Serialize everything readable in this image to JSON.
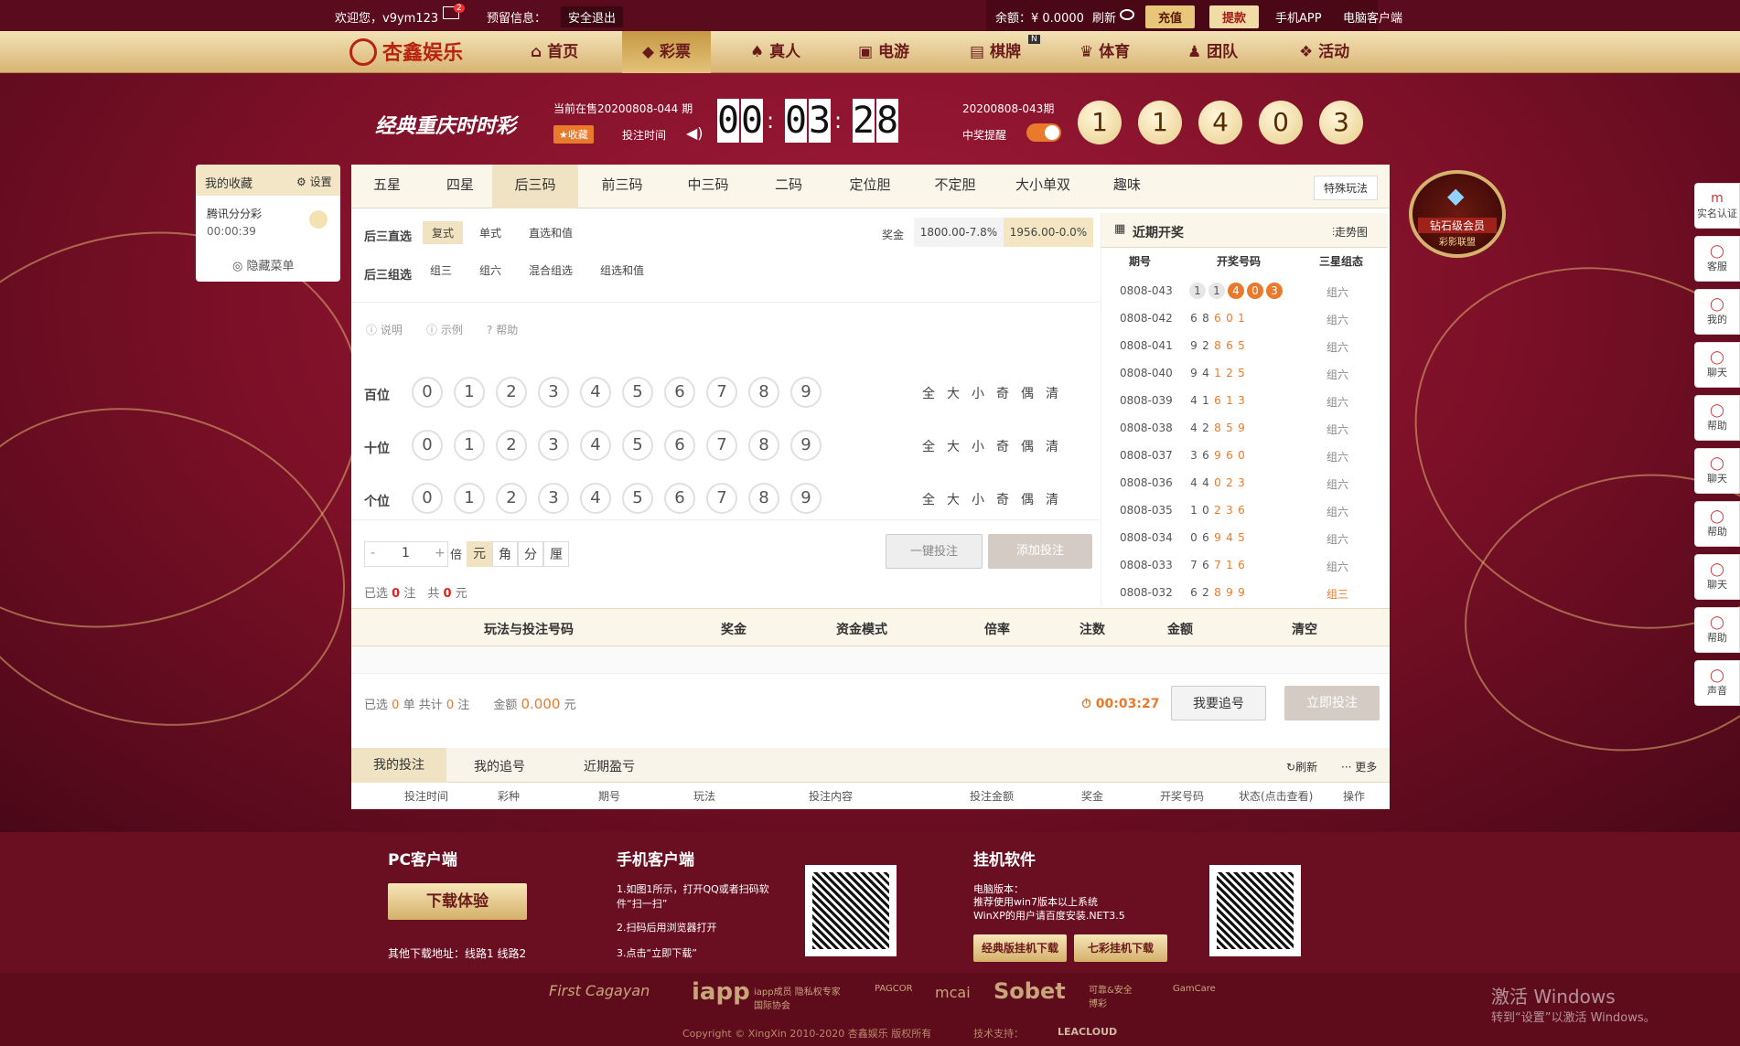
{
  "topbar": {
    "welcome": "欢迎您，v9ym123",
    "mail_count": "2",
    "notice_label": "预留信息：",
    "logout": "安全退出",
    "balance": "余额：¥ 0.0000",
    "refresh": "刷新",
    "recharge": "充值",
    "withdraw": "提款",
    "mobile_app": "手机APP",
    "pc_client": "电脑客户端"
  },
  "nav": {
    "logo": "杏鑫娱乐",
    "items": [
      "首页",
      "彩票",
      "真人",
      "电游",
      "棋牌",
      "体育",
      "团队",
      "活动"
    ],
    "active": "彩票",
    "badge": "N"
  },
  "lottery": {
    "name": "经典重庆时时彩",
    "selling": "当前在售20200808-044 期",
    "favorite": "收藏",
    "bet_time_label": "投注时间",
    "countdown": [
      "0",
      "0",
      "0",
      "3",
      "2",
      "8"
    ],
    "last_issue": "20200808-043期",
    "win_notice": "中奖提醒",
    "last_draw": [
      "1",
      "1",
      "4",
      "0",
      "3"
    ]
  },
  "favorites": {
    "title": "我的收藏",
    "settings": "设置",
    "item_name": "腾讯分分彩",
    "item_time": "00:00:39",
    "hide_menu": "隐藏菜单"
  },
  "tabs": [
    "五星",
    "四星",
    "后三码",
    "前三码",
    "中三码",
    "二码",
    "定位胆",
    "不定胆",
    "大小单双",
    "趣味"
  ],
  "active_tab": "后三码",
  "special_play": "特殊玩法",
  "play": {
    "direct_label": "后三直选",
    "direct_opts": [
      "复式",
      "单式",
      "直选和值"
    ],
    "group_label": "后三组选",
    "group_opts": [
      "组三",
      "组六",
      "混合组选",
      "组选和值"
    ],
    "prize_label": "奖金",
    "prize_opts": [
      "1800.00-7.8%",
      "1956.00-0.0%"
    ]
  },
  "help": [
    "说明",
    "示例",
    "帮助"
  ],
  "positions": [
    {
      "label": "百位"
    },
    {
      "label": "十位"
    },
    {
      "label": "个位"
    }
  ],
  "numbers": [
    "0",
    "1",
    "2",
    "3",
    "4",
    "5",
    "6",
    "7",
    "8",
    "9"
  ],
  "quick": [
    "全",
    "大",
    "小",
    "奇",
    "偶",
    "清"
  ],
  "bet": {
    "minus": "-",
    "qty": "1",
    "plus": "+",
    "multiple": "倍",
    "units": [
      "元",
      "角",
      "分",
      "厘"
    ],
    "one_click": "一键投注",
    "add": "添加投注",
    "selected_pre": "已选",
    "selected_n": "0",
    "selected_mid": "注　共",
    "selected_amt": "0",
    "selected_post": "元"
  },
  "cart_cols": [
    "玩法与投注号码",
    "奖金",
    "资金模式",
    "倍率",
    "注数",
    "金额",
    "清空"
  ],
  "summary": {
    "text1": "已选",
    "n1": "0",
    "text2": "单 共计",
    "n2": "0",
    "text3": "注",
    "amt_label": "金额",
    "amt": "0.000",
    "amt_unit": "元",
    "timer": "00:03:27",
    "chase": "我要追号",
    "submit": "立即投注"
  },
  "records": {
    "tabs": [
      "我的投注",
      "我的追号",
      "近期盈亏"
    ],
    "refresh": "刷新",
    "more": "更多",
    "cols": [
      "投注时间",
      "彩种",
      "期号",
      "玩法",
      "投注内容",
      "投注金额",
      "奖金",
      "开奖号码",
      "状态(点击查看)",
      "操作"
    ]
  },
  "recent": {
    "title": "近期开奖",
    "trend": "走势图",
    "cols": [
      "期号",
      "开奖号码",
      "三星组态"
    ],
    "rows": [
      {
        "issue": "0808-043",
        "nums": [
          "1",
          "1",
          "4",
          "0",
          "3"
        ],
        "type": "组六"
      },
      {
        "issue": "0808-042",
        "nums": [
          "6",
          "8",
          "6",
          "0",
          "1"
        ],
        "type": "组六"
      },
      {
        "issue": "0808-041",
        "nums": [
          "9",
          "2",
          "8",
          "6",
          "5"
        ],
        "type": "组六"
      },
      {
        "issue": "0808-040",
        "nums": [
          "9",
          "4",
          "1",
          "2",
          "5"
        ],
        "type": "组六"
      },
      {
        "issue": "0808-039",
        "nums": [
          "4",
          "1",
          "6",
          "1",
          "3"
        ],
        "type": "组六"
      },
      {
        "issue": "0808-038",
        "nums": [
          "4",
          "2",
          "8",
          "5",
          "9"
        ],
        "type": "组六"
      },
      {
        "issue": "0808-037",
        "nums": [
          "3",
          "6",
          "9",
          "6",
          "0"
        ],
        "type": "组六"
      },
      {
        "issue": "0808-036",
        "nums": [
          "4",
          "4",
          "0",
          "2",
          "3"
        ],
        "type": "组六"
      },
      {
        "issue": "0808-035",
        "nums": [
          "1",
          "0",
          "2",
          "3",
          "6"
        ],
        "type": "组六"
      },
      {
        "issue": "0808-034",
        "nums": [
          "0",
          "6",
          "9",
          "4",
          "5"
        ],
        "type": "组六"
      },
      {
        "issue": "0808-033",
        "nums": [
          "7",
          "6",
          "7",
          "1",
          "6"
        ],
        "type": "组六"
      },
      {
        "issue": "0808-032",
        "nums": [
          "6",
          "2",
          "8",
          "9",
          "9"
        ],
        "type": "组三"
      }
    ]
  },
  "badge": {
    "line1": "钻石级会员",
    "line2": "彩影联盟"
  },
  "rightbar": [
    "实名认证",
    "客服",
    "我的",
    "聊天",
    "帮助",
    "聊天",
    "帮助",
    "聊天",
    "帮助",
    "声音"
  ],
  "footer": {
    "pc_title": "PC客户端",
    "download": "下载体验",
    "other": "其他下载地址：线路1  线路2",
    "mobile_title": "手机客户端",
    "m1": "1.如图1所示，打开QQ或者扫码软件“扫一扫”",
    "m2": "2.扫码后用浏览器打开",
    "m3": "3.点击“立即下载”",
    "bot_title": "挂机软件",
    "b0": "电脑版本：",
    "b1": "推荐使用win7版本以上系统",
    "b2": "WinXP的用户请百度安装.NET3.5",
    "classic": "经典版挂机下载",
    "seven": "七彩挂机下载",
    "copyright": "Copyright © XingXin 2010-2020 杏鑫娱乐 版权所有",
    "tech": "技术支持：",
    "partners": [
      "First Cagayan",
      "iapp",
      "iapp成员 隐私权专家国际协会",
      "PAGCOR",
      "mcai",
      "Sobet",
      "可靠&安全 博彩",
      "GamCare"
    ],
    "leacloud": "LEACLOUD"
  },
  "activation": {
    "l1": "激活 Windows",
    "l2": "转到“设置”以激活 Windows。"
  },
  "colors": {
    "accent": "#e97a2c",
    "brand": "#7d1028",
    "gold": "#d8b574"
  }
}
